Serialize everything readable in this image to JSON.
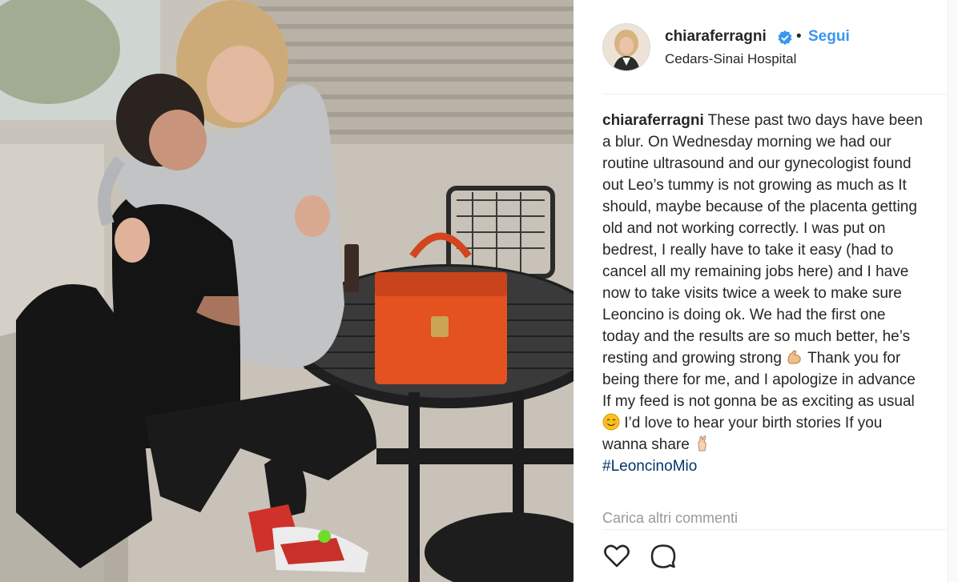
{
  "post": {
    "image_alt": "Couple hugging at an outdoor table with an orange handbag",
    "author": {
      "username": "chiaraferragni",
      "verified": true,
      "separator": "•",
      "follow_label": "Segui",
      "location": "Cedars-Sinai Hospital"
    },
    "caption": {
      "username": "chiaraferragni",
      "part1": " These past two days have been a blur. On Wednesday morning we had our routine ultrasound and our gynecologist found out Leo’s tummy is not growing as much as It should, maybe because of the placenta getting old and not working correctly. I was put on bedrest, I really have to take it easy (had to cancel all my remaining jobs here) and I have now to take visits twice a week to make sure Leoncino is doing ok. We had the first one today and the results are so much better, he’s resting and growing strong ",
      "part2": " Thank you for being there for me, and I apologize in advance If my feed is not gonna be as exciting as usual ",
      "part3": " I’d love to hear your birth stories If you wanna share ",
      "hashtag": "#LeoncinoMio",
      "emojis": [
        "flexed-biceps-icon",
        "smiling-face-icon",
        "crossed-fingers-icon"
      ]
    },
    "load_more_comments": "Carica altri commenti",
    "actions": [
      "heart-icon",
      "comment-icon"
    ],
    "colors": {
      "link_blue": "#3897f0",
      "hashtag_blue": "#003569",
      "muted_gray": "#999999",
      "text": "#262626"
    }
  }
}
